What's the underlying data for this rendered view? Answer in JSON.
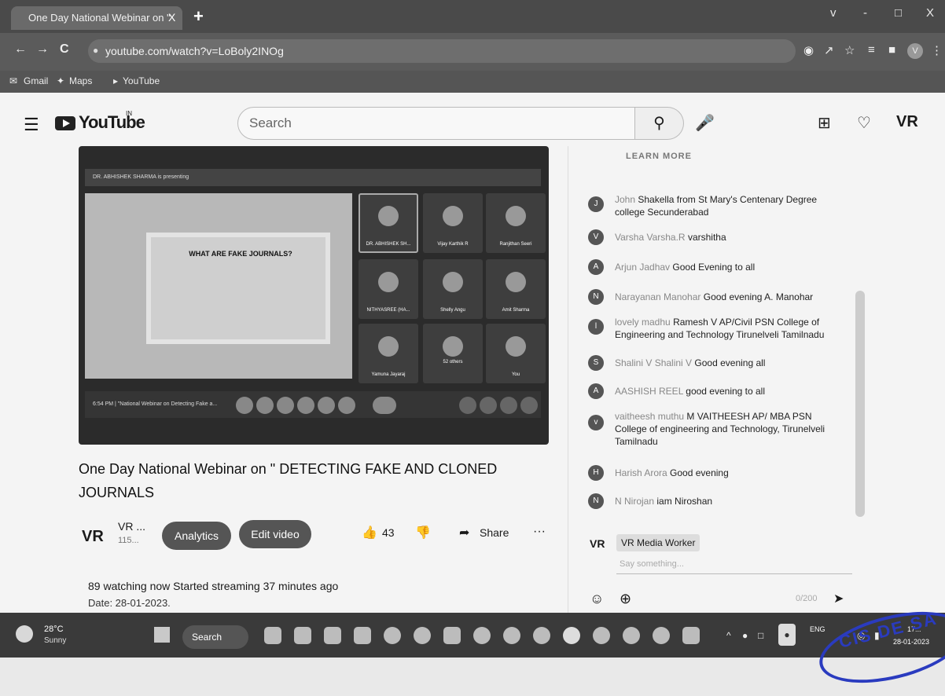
{
  "browser": {
    "tab_title": "One Day National Webinar on \"",
    "tab_close": "X",
    "new_tab": "+",
    "url": "youtube.com/watch?v=LoBoly2INOg",
    "window_controls": [
      "v",
      "-",
      "□",
      "X"
    ],
    "nav": {
      "back": "←",
      "forward": "→",
      "reload": "C"
    },
    "bookmarks": [
      "Gmail",
      "Maps",
      "YouTube"
    ],
    "profile_initial": "V"
  },
  "youtube": {
    "logo_text": "YouTube",
    "logo_sup": "IN",
    "search_placeholder": "Search",
    "icons": [
      "hamburger-icon",
      "search-icon",
      "mic-icon",
      "create-icon",
      "bell-icon",
      "vr-logo-icon"
    ],
    "header_logo": "VR"
  },
  "video": {
    "presenter_banner": "DR. ABHISHEK SHARMA is presenting",
    "slide_title": "WHAT ARE FAKE JOURNALS?",
    "participants": [
      "DR. ABHISHEK SH...",
      "Vijay Karthik R",
      "Ranjithan Seeri",
      "NITHYASREE (HA...",
      "Shelly Angu",
      "Amit Sharma",
      "Yamuna Jayaraj",
      "52 others",
      "You"
    ],
    "bottom_bar": "6:54 PM | \"National Webinar on Detecting Fake a..."
  },
  "meta": {
    "title": "One Day National Webinar on \" DETECTING FAKE AND CLONED JOURNALS",
    "channel_logo": "VR",
    "channel_name": "VR ...",
    "subscribers": "115...",
    "analytics": "Analytics",
    "edit_video": "Edit video",
    "likes": "43",
    "share": "Share",
    "more": "···",
    "watching": "89 watching now  Started streaming 37 minutes ago",
    "date": "Date: 28-01-2023."
  },
  "chat": {
    "learn_more": "LEARN MORE",
    "messages": [
      {
        "initial": "J",
        "author": "John",
        "text": "Shakella from St Mary's Centenary Degree college Secunderabad"
      },
      {
        "initial": "V",
        "author": "Varsha Varsha.R",
        "text": "varshitha"
      },
      {
        "initial": "A",
        "author": "Arjun Jadhav",
        "text": "Good Evening to all"
      },
      {
        "initial": "N",
        "author": "Narayanan Manohar",
        "text": "Good evening A. Manohar"
      },
      {
        "initial": "l",
        "author": "lovely madhu",
        "text": "Ramesh V AP/Civil PSN College of Engineering and Technology Tirunelveli Tamilnadu"
      },
      {
        "initial": "S",
        "author": "Shalini V Shalini V",
        "text": "Good evening all"
      },
      {
        "initial": "A",
        "author": "AASHISH REEL",
        "text": "good evening to all"
      },
      {
        "initial": "v",
        "author": "vaitheesh muthu",
        "text": "M VAITHEESH AP/ MBA PSN College of engineering and Technology, Tirunelveli Tamilnadu"
      },
      {
        "initial": "H",
        "author": "Harish Arora",
        "text": "Good evening"
      },
      {
        "initial": "N",
        "author": "N Nirojan",
        "text": "iam Niroshan"
      }
    ],
    "me_logo": "VR",
    "me_name": "VR Media Worker",
    "placeholder": "Say something...",
    "char_count": "0/200",
    "stamp_text": "CIS DE SA"
  },
  "taskbar": {
    "temp": "28°C",
    "condition": "Sunny",
    "search": "Search",
    "lang": "ENG",
    "time": "17:..",
    "date": "28-01-2023"
  }
}
